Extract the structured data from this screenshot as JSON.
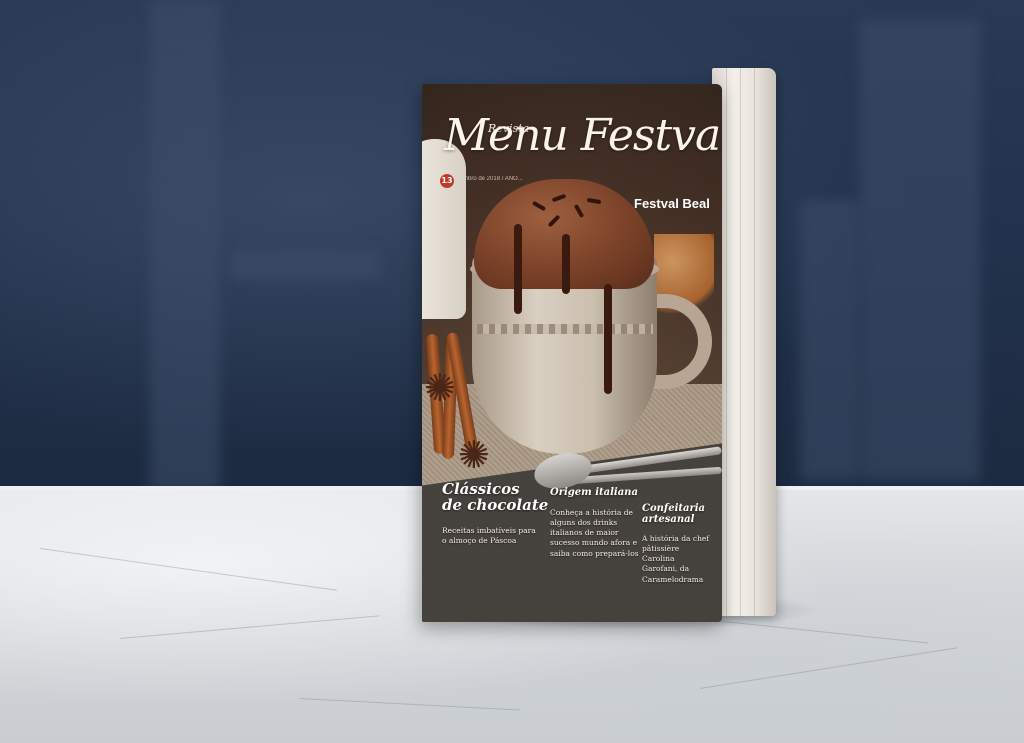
{
  "magazine": {
    "kicker": "Revista",
    "title": "Menu Festval",
    "badge": "13",
    "issue_meta": "...mbro de 2018 / ANO...",
    "brand": "Festval Beal",
    "stories": [
      {
        "title_line1": "Clássicos",
        "title_line2": "de chocolate",
        "body": "Receitas imbatíveis para o almoço de Páscoa"
      },
      {
        "title_line1": "Origem italiana",
        "title_line2": "",
        "body": "Conheça a história de alguns dos drinks italianos de maior sucesso mundo afora e saiba como prepará-los"
      },
      {
        "title_line1": "Confeitaria",
        "title_line2": "artesanal",
        "body": "A história da chef pâtissière Carolina Garofani, da Caramelodrama"
      }
    ]
  },
  "colors": {
    "wall": "#22324c",
    "marble": "#d6d9dc",
    "cake": "#7a4128",
    "chocolate": "#3a1a0e",
    "badge": "#c0392b"
  }
}
